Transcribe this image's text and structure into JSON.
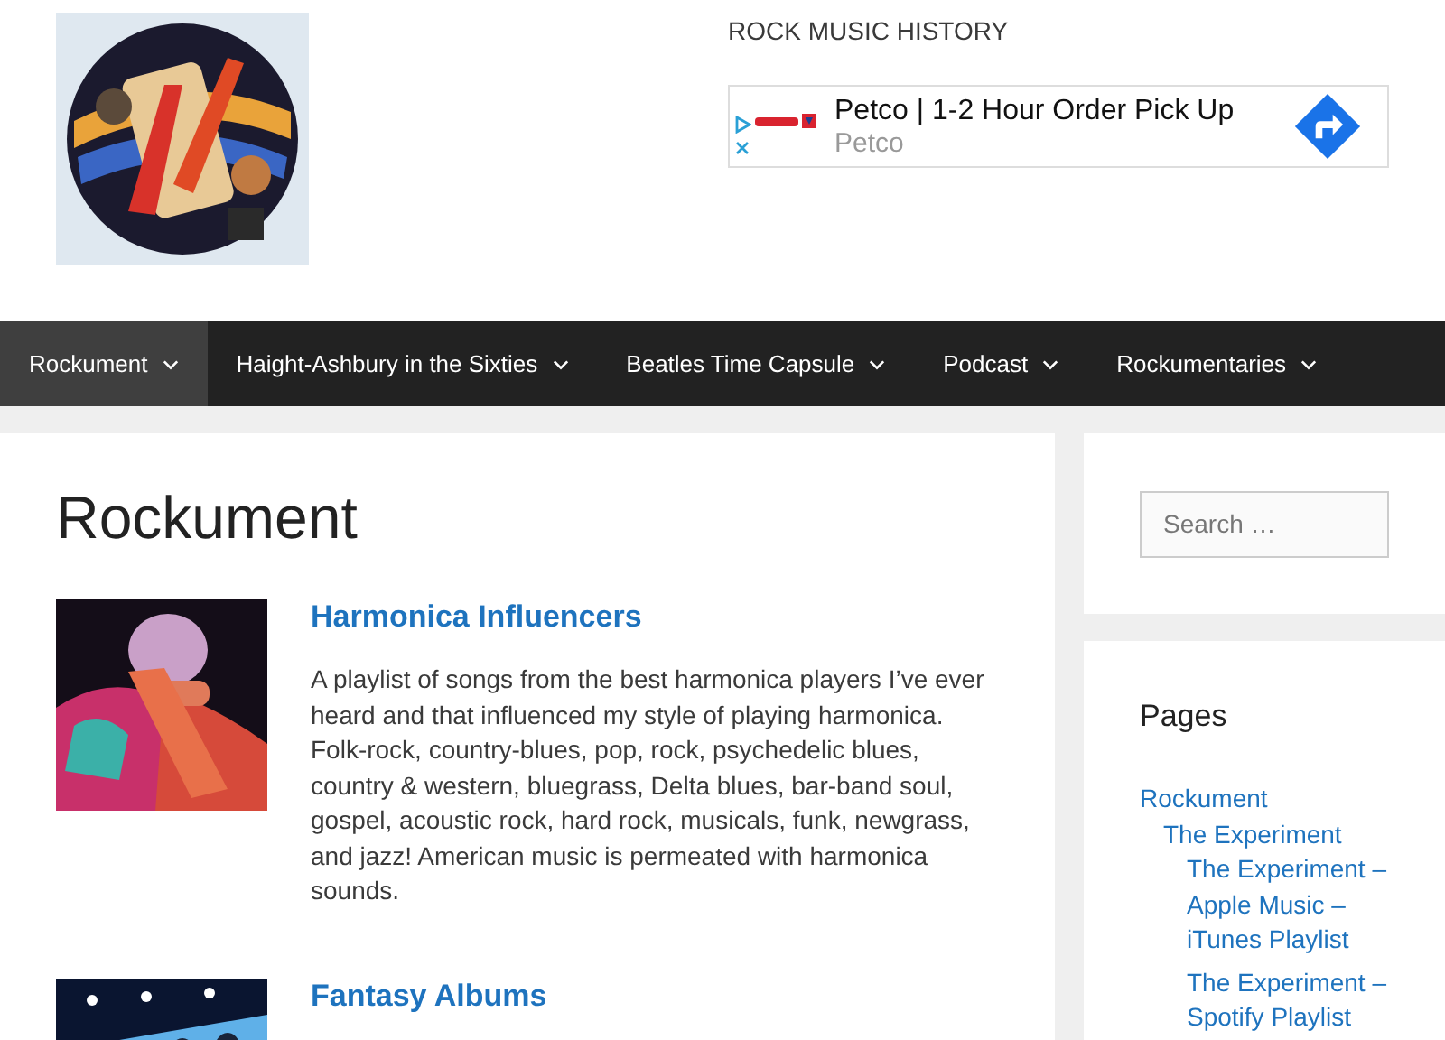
{
  "header": {
    "tagline": "ROCK MUSIC HISTORY",
    "ad": {
      "title": "Petco | 1-2 Hour Order Pick Up",
      "advertiser": "Petco"
    }
  },
  "nav": [
    {
      "label": "Rockument",
      "selected": true
    },
    {
      "label": "Haight-Ashbury in the Sixties",
      "selected": false
    },
    {
      "label": "Beatles Time Capsule",
      "selected": false
    },
    {
      "label": "Podcast",
      "selected": false
    },
    {
      "label": "Rockumentaries",
      "selected": false
    }
  ],
  "main": {
    "title": "Rockument",
    "posts": [
      {
        "title": "Harmonica Influencers",
        "excerpt": "A playlist of songs from the best harmonica players I’ve ever heard and that influenced my style of playing harmonica. Folk-rock, country-blues, pop, rock, psychedelic blues, country & western, bluegrass, Delta blues, bar-band soul, gospel, acoustic rock, hard rock, musicals, funk, newgrass, and jazz! American music is permeated with harmonica sounds."
      },
      {
        "title": "Fantasy Albums"
      }
    ]
  },
  "sidebar": {
    "search": {
      "placeholder": "Search …"
    },
    "pages": {
      "title": "Pages",
      "items": [
        {
          "label": "Rockument",
          "children": [
            {
              "label": "The Experiment",
              "children": [
                {
                  "label": "The Experiment – Apple Music – iTunes Playlist"
                },
                {
                  "label": "The Experiment – Spotify Playlist"
                }
              ]
            }
          ]
        }
      ]
    }
  }
}
